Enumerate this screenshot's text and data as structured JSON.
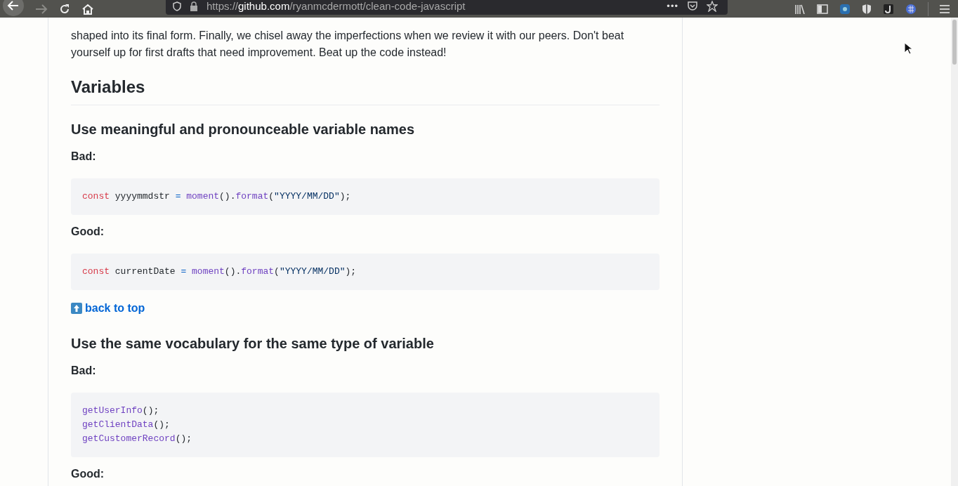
{
  "browser": {
    "url": {
      "scheme": "https://",
      "host": "github.com",
      "path": "/ryanmcdermott/clean-code-javascript"
    },
    "more": "•••",
    "forward_disabled": true
  },
  "content": [
    {
      "kind": "paragraph",
      "lines": [
        "shaped into its final form. Finally, we chisel away the imperfections when we review it with our peers. Don't beat",
        "yourself up for first drafts that need improvement. Beat up the code instead!"
      ]
    },
    {
      "kind": "h2",
      "text": "Variables"
    },
    {
      "kind": "h3",
      "text": "Use meaningful and pronounceable variable names"
    },
    {
      "kind": "label",
      "text": "Bad:"
    },
    {
      "kind": "code",
      "lines": [
        [
          {
            "kind": "keyword",
            "text": "const"
          },
          {
            "kind": "plain",
            "text": " yyyymmdstr "
          },
          {
            "kind": "operator",
            "text": "= "
          },
          {
            "kind": "func",
            "text": "moment"
          },
          {
            "kind": "plain",
            "text": "()."
          },
          {
            "kind": "func",
            "text": "format"
          },
          {
            "kind": "plain",
            "text": "("
          },
          {
            "kind": "string",
            "text": "\"YYYY/MM/DD\""
          },
          {
            "kind": "plain",
            "text": ");"
          }
        ]
      ]
    },
    {
      "kind": "label",
      "text": "Good:"
    },
    {
      "kind": "code",
      "lines": [
        [
          {
            "kind": "keyword",
            "text": "const"
          },
          {
            "kind": "plain",
            "text": " currentDate "
          },
          {
            "kind": "operator",
            "text": "= "
          },
          {
            "kind": "func",
            "text": "moment"
          },
          {
            "kind": "plain",
            "text": "()."
          },
          {
            "kind": "func",
            "text": "format"
          },
          {
            "kind": "plain",
            "text": "("
          },
          {
            "kind": "string",
            "text": "\"YYYY/MM/DD\""
          },
          {
            "kind": "plain",
            "text": ");"
          }
        ]
      ]
    },
    {
      "kind": "link",
      "text": "back to top"
    },
    {
      "kind": "h3",
      "text": "Use the same vocabulary for the same type of variable"
    },
    {
      "kind": "label",
      "text": "Bad:"
    },
    {
      "kind": "code",
      "lines": [
        [
          {
            "kind": "func",
            "text": "getUserInfo"
          },
          {
            "kind": "plain",
            "text": "();"
          }
        ],
        [
          {
            "kind": "func",
            "text": "getClientData"
          },
          {
            "kind": "plain",
            "text": "();"
          }
        ],
        [
          {
            "kind": "func",
            "text": "getCustomerRecord"
          },
          {
            "kind": "plain",
            "text": "();"
          }
        ]
      ]
    },
    {
      "kind": "label",
      "text": "Good:"
    }
  ]
}
